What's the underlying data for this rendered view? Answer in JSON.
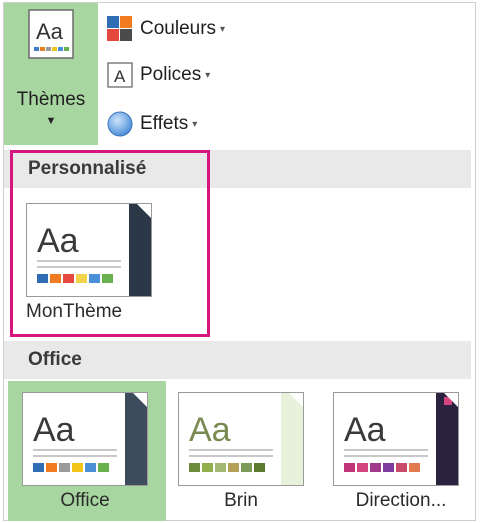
{
  "ribbon": {
    "themes_label": "Thèmes",
    "themes_caret": "▼",
    "commands": [
      {
        "label": "Couleurs",
        "icon": "colors-icon"
      },
      {
        "label": "Polices",
        "icon": "fonts-icon"
      },
      {
        "label": "Effets",
        "icon": "effects-icon"
      }
    ],
    "dropdown_glyph": "▾"
  },
  "sections": {
    "custom_title": "Personnalisé",
    "office_title": "Office"
  },
  "themes": {
    "custom": [
      {
        "name": "MonThème",
        "preview_text": "Aa"
      }
    ],
    "office": [
      {
        "name": "Office",
        "preview_text": "Aa",
        "selected": true
      },
      {
        "name": "Brin",
        "preview_text": "Aa"
      },
      {
        "name": "Direction...",
        "preview_text": "Aa"
      }
    ]
  },
  "colors": {
    "selected_bg": "#a8d6a0",
    "highlight_border": "#d6157d",
    "section_bg": "#e9e9e9"
  }
}
